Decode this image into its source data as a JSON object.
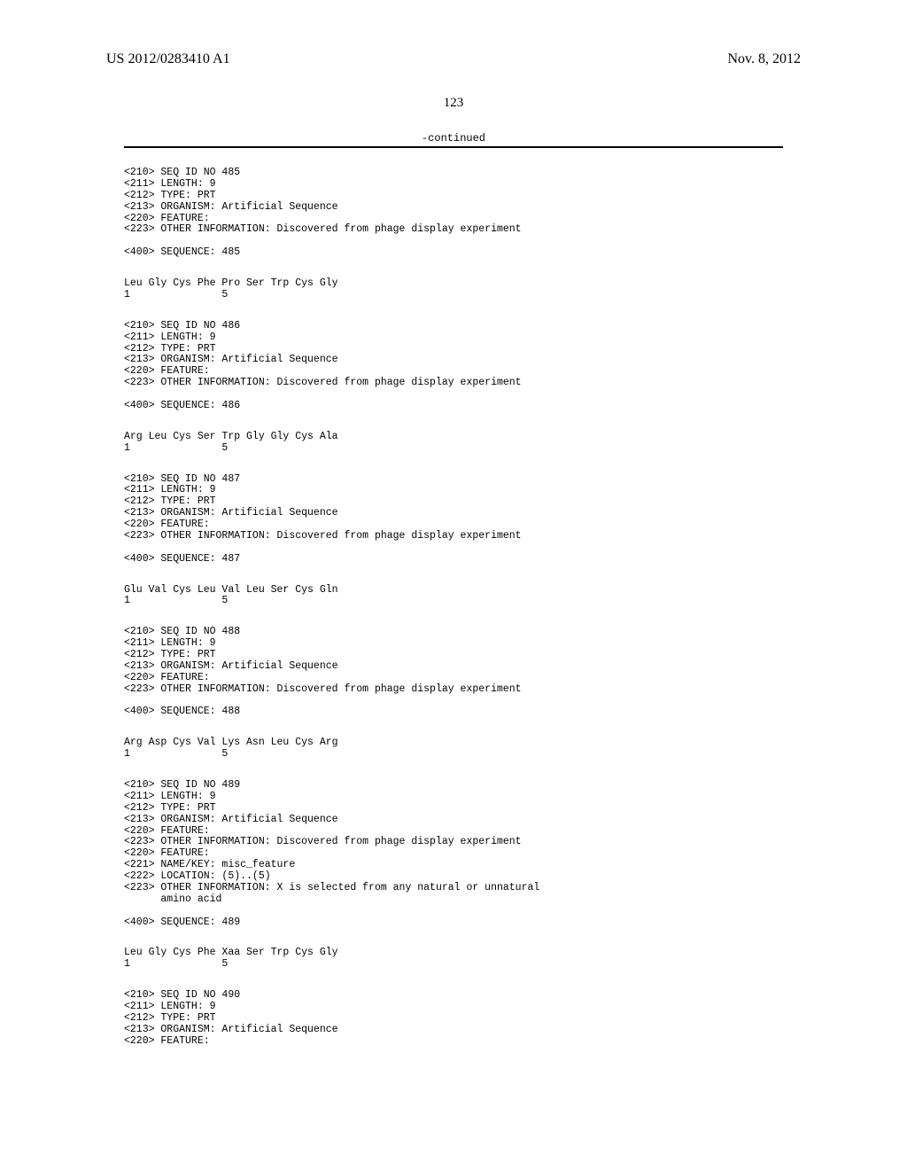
{
  "header": {
    "publication_number": "US 2012/0283410 A1",
    "publication_date": "Nov. 8, 2012"
  },
  "page_number": "123",
  "continued_label": "-continued",
  "entries": [
    {
      "meta": "<210> SEQ ID NO 485\n<211> LENGTH: 9\n<212> TYPE: PRT\n<213> ORGANISM: Artificial Sequence\n<220> FEATURE:\n<223> OTHER INFORMATION: Discovered from phage display experiment\n\n<400> SEQUENCE: 485",
      "sequence": "Leu Gly Cys Phe Pro Ser Trp Cys Gly\n1               5"
    },
    {
      "meta": "<210> SEQ ID NO 486\n<211> LENGTH: 9\n<212> TYPE: PRT\n<213> ORGANISM: Artificial Sequence\n<220> FEATURE:\n<223> OTHER INFORMATION: Discovered from phage display experiment\n\n<400> SEQUENCE: 486",
      "sequence": "Arg Leu Cys Ser Trp Gly Gly Cys Ala\n1               5"
    },
    {
      "meta": "<210> SEQ ID NO 487\n<211> LENGTH: 9\n<212> TYPE: PRT\n<213> ORGANISM: Artificial Sequence\n<220> FEATURE:\n<223> OTHER INFORMATION: Discovered from phage display experiment\n\n<400> SEQUENCE: 487",
      "sequence": "Glu Val Cys Leu Val Leu Ser Cys Gln\n1               5"
    },
    {
      "meta": "<210> SEQ ID NO 488\n<211> LENGTH: 9\n<212> TYPE: PRT\n<213> ORGANISM: Artificial Sequence\n<220> FEATURE:\n<223> OTHER INFORMATION: Discovered from phage display experiment\n\n<400> SEQUENCE: 488",
      "sequence": "Arg Asp Cys Val Lys Asn Leu Cys Arg\n1               5"
    },
    {
      "meta": "<210> SEQ ID NO 489\n<211> LENGTH: 9\n<212> TYPE: PRT\n<213> ORGANISM: Artificial Sequence\n<220> FEATURE:\n<223> OTHER INFORMATION: Discovered from phage display experiment\n<220> FEATURE:\n<221> NAME/KEY: misc_feature\n<222> LOCATION: (5)..(5)\n<223> OTHER INFORMATION: X is selected from any natural or unnatural\n      amino acid\n\n<400> SEQUENCE: 489",
      "sequence": "Leu Gly Cys Phe Xaa Ser Trp Cys Gly\n1               5"
    },
    {
      "meta": "<210> SEQ ID NO 490\n<211> LENGTH: 9\n<212> TYPE: PRT\n<213> ORGANISM: Artificial Sequence\n<220> FEATURE:",
      "sequence": ""
    }
  ]
}
